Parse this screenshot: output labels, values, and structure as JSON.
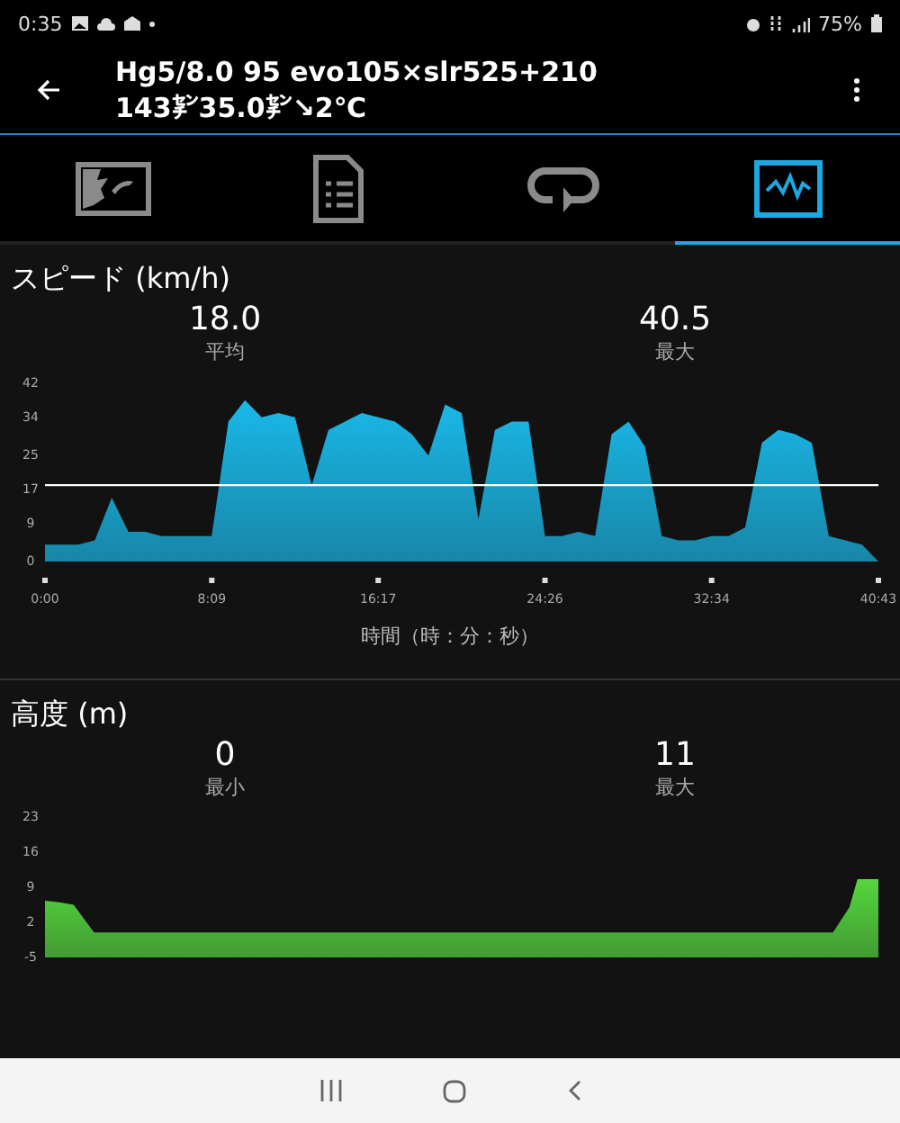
{
  "status_bar": {
    "time": "0:35",
    "battery": "75%"
  },
  "header": {
    "title": "Hg5/8.0 95 evo105×slr525+210",
    "subtitle": "143㌢35.0㌢↘2℃"
  },
  "tabs": [
    {
      "kind": "map",
      "selected": false
    },
    {
      "kind": "document",
      "selected": false
    },
    {
      "kind": "loop",
      "selected": false
    },
    {
      "kind": "activity",
      "selected": true
    }
  ],
  "sections": [
    {
      "title": "スピード (km/h)",
      "stats": [
        {
          "value": "18.0",
          "label": "平均"
        },
        {
          "value": "40.5",
          "label": "最大"
        }
      ],
      "chart_data": {
        "type": "area",
        "xlabel": "時間（時：分：秒）",
        "xlim": [
          0,
          40.72
        ],
        "ylim": [
          0,
          42
        ],
        "ref_lines": [
          {
            "axis": "y",
            "value": 18
          }
        ],
        "xticks": [
          {
            "value": 0,
            "label": "0:00"
          },
          {
            "value": 8.15,
            "label": "8:09"
          },
          {
            "value": 16.28,
            "label": "16:17"
          },
          {
            "value": 24.43,
            "label": "24:26"
          },
          {
            "value": 32.57,
            "label": "32:34"
          },
          {
            "value": 40.72,
            "label": "40:43"
          }
        ],
        "yticks": [
          0,
          9,
          17,
          25,
          34,
          42
        ],
        "series": [
          {
            "color": "#1ab8e8",
            "x": [
              0,
              0.81,
              1.63,
              2.44,
              3.26,
              4.07,
              4.89,
              5.7,
              6.52,
              7.33,
              8.14,
              8.96,
              9.77,
              10.59,
              11.4,
              12.22,
              13.03,
              13.85,
              14.66,
              15.48,
              16.29,
              17.1,
              17.92,
              18.73,
              19.55,
              20.36,
              21.18,
              21.99,
              22.81,
              23.62,
              24.43,
              25.25,
              26.06,
              26.88,
              27.69,
              28.51,
              29.32,
              30.14,
              30.95,
              31.77,
              32.58,
              33.4,
              34.21,
              35.03,
              35.84,
              36.66,
              37.47,
              38.29,
              39.1,
              39.92,
              40.72
            ],
            "values": [
              4,
              4,
              4,
              5,
              15,
              7,
              7,
              6,
              6,
              6,
              6,
              33,
              38,
              34,
              35,
              34,
              18,
              31,
              33,
              35,
              34,
              33,
              30,
              25,
              37,
              35,
              10,
              31,
              33,
              33,
              6,
              6,
              7,
              6,
              30,
              33,
              27,
              6,
              5,
              5,
              6,
              6,
              8,
              28,
              31,
              30,
              28,
              6,
              5,
              4,
              0
            ]
          }
        ]
      }
    },
    {
      "title": "高度 (m)",
      "stats": [
        {
          "value": "0",
          "label": "最小"
        },
        {
          "value": "11",
          "label": "最大"
        }
      ],
      "chart_data": {
        "type": "area",
        "xlim": [
          0,
          40.72
        ],
        "ylim": [
          -5,
          23
        ],
        "yticks": [
          -5,
          2,
          9,
          16,
          23
        ],
        "series": [
          {
            "color": "#55d63f",
            "x": [
              0,
              0,
              0.7,
              1.4,
              2.4,
              38.5,
              39.3,
              39.7,
              40.72,
              40.72
            ],
            "values": [
              -5,
              6.3,
              6,
              5.5,
              0,
              0,
              5,
              10.6,
              10.6,
              -5
            ]
          }
        ]
      }
    }
  ]
}
